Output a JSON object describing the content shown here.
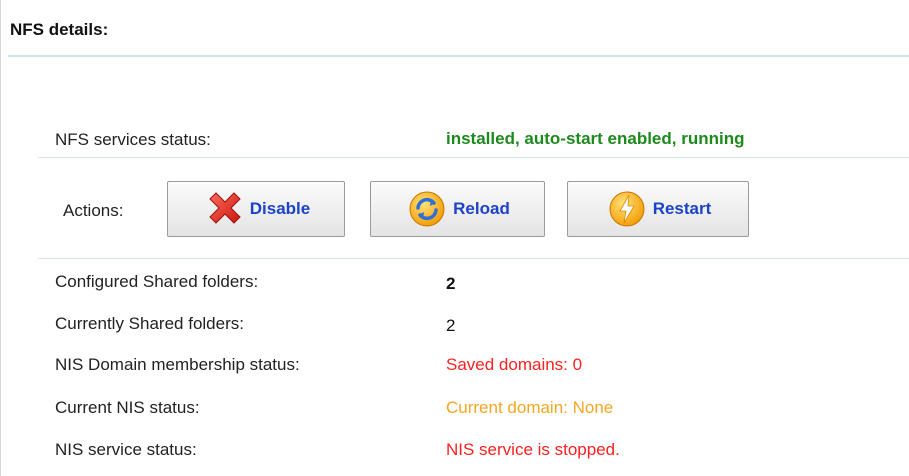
{
  "section": {
    "title": "NFS details:"
  },
  "status": {
    "label": "NFS services status:",
    "value": "installed, auto-start enabled, running",
    "value_color": "#1e8a1e"
  },
  "actions": {
    "label": "Actions:",
    "buttons": [
      {
        "label": "Disable",
        "icon": "red-x-icon"
      },
      {
        "label": "Reload",
        "icon": "refresh-icon"
      },
      {
        "label": "Restart",
        "icon": "power-restart-icon"
      }
    ],
    "button_text_color": "#1c43c8"
  },
  "info": [
    {
      "label": "Configured Shared folders:",
      "value": "2"
    },
    {
      "label": "Currently Shared folders:",
      "value": "2"
    },
    {
      "label": "NIS Domain membership status:",
      "value": "Saved domains: 0",
      "color": "#ff2020"
    },
    {
      "label": "Current NIS status:",
      "value": "Current domain: None",
      "color": "#f5a623"
    },
    {
      "label": "NIS service status:",
      "value": "NIS service is stopped.",
      "color": "#ff2020"
    }
  ]
}
